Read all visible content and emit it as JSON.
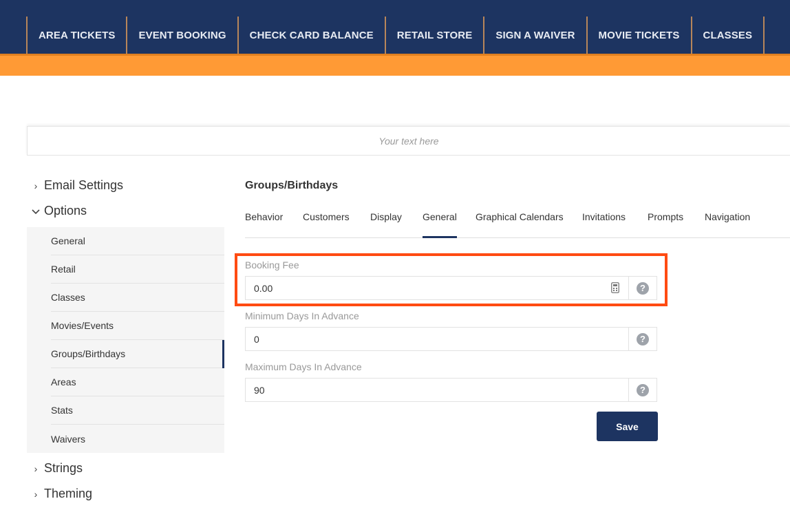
{
  "nav": {
    "items": [
      "AREA TICKETS",
      "EVENT BOOKING",
      "CHECK CARD BALANCE",
      "RETAIL STORE",
      "SIGN A WAIVER",
      "MOVIE TICKETS",
      "CLASSES"
    ]
  },
  "banner": {
    "text": "Your text here"
  },
  "sidebar": {
    "email_settings": "Email Settings",
    "options": "Options",
    "sub_items": [
      "General",
      "Retail",
      "Classes",
      "Movies/Events",
      "Groups/Birthdays",
      "Areas",
      "Stats",
      "Waivers"
    ],
    "active_sub": "Groups/Birthdays",
    "strings": "Strings",
    "theming": "Theming"
  },
  "main": {
    "title": "Groups/Birthdays",
    "tabs": [
      "Behavior",
      "Customers",
      "Display",
      "General",
      "Graphical Calendars",
      "Invitations",
      "Prompts",
      "Navigation"
    ],
    "active_tab": "General",
    "fields": [
      {
        "label": "Booking Fee",
        "value": "0.00"
      },
      {
        "label": "Minimum Days In Advance",
        "value": "0"
      },
      {
        "label": "Maximum Days In Advance",
        "value": "90"
      }
    ],
    "help_glyph": "?",
    "save_label": "Save"
  },
  "colors": {
    "nav_bg": "#1d3461",
    "accent_orange": "#ff9a35",
    "highlight": "#ff4b12",
    "primary_button": "#1d3461"
  }
}
